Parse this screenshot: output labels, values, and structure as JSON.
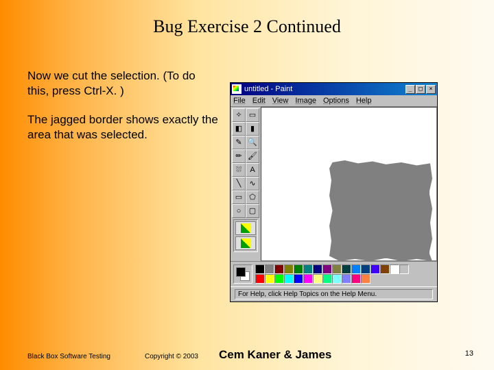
{
  "slide": {
    "title": "Bug Exercise 2 Continued",
    "para1": "Now we cut the selection. (To do this, press Ctrl-X. )",
    "para2": "The jagged border shows exactly the area that was selected."
  },
  "paint": {
    "title": "untitled - Paint",
    "titlebar_buttons": {
      "minimize": "_",
      "maximize": "□",
      "close": "×"
    },
    "menus": {
      "file": "File",
      "edit": "Edit",
      "view": "View",
      "image": "Image",
      "options": "Options",
      "help": "Help"
    },
    "tools": {
      "freeselect": "✧",
      "rectselect": "▭",
      "eraser": "◧",
      "fill": "▮",
      "picker": "✎",
      "magnify": "🔍",
      "pencil": "✏",
      "brush": "🖌",
      "airbrush": "⛆",
      "text": "A",
      "line": "╲",
      "curve": "∿",
      "rect": "▭",
      "poly": "⬠",
      "ellipse": "○",
      "roundrect": "▢"
    },
    "palette_row1": [
      "#000000",
      "#808080",
      "#800000",
      "#808000",
      "#008000",
      "#008080",
      "#000080",
      "#800080",
      "#808040",
      "#004040",
      "#0080ff",
      "#004080",
      "#4000ff",
      "#804000"
    ],
    "palette_row2": [
      "#ffffff",
      "#c0c0c0",
      "#ff0000",
      "#ffff00",
      "#00ff00",
      "#00ffff",
      "#0000ff",
      "#ff00ff",
      "#ffff80",
      "#00ff80",
      "#80ffff",
      "#8080ff",
      "#ff0080",
      "#ff8040"
    ],
    "status": "For Help, click Help Topics on the Help Menu."
  },
  "footer": {
    "left": "Black Box Software Testing",
    "copyright": "Copyright ©  2003",
    "authors": "Cem Kaner & James",
    "page": "13"
  }
}
